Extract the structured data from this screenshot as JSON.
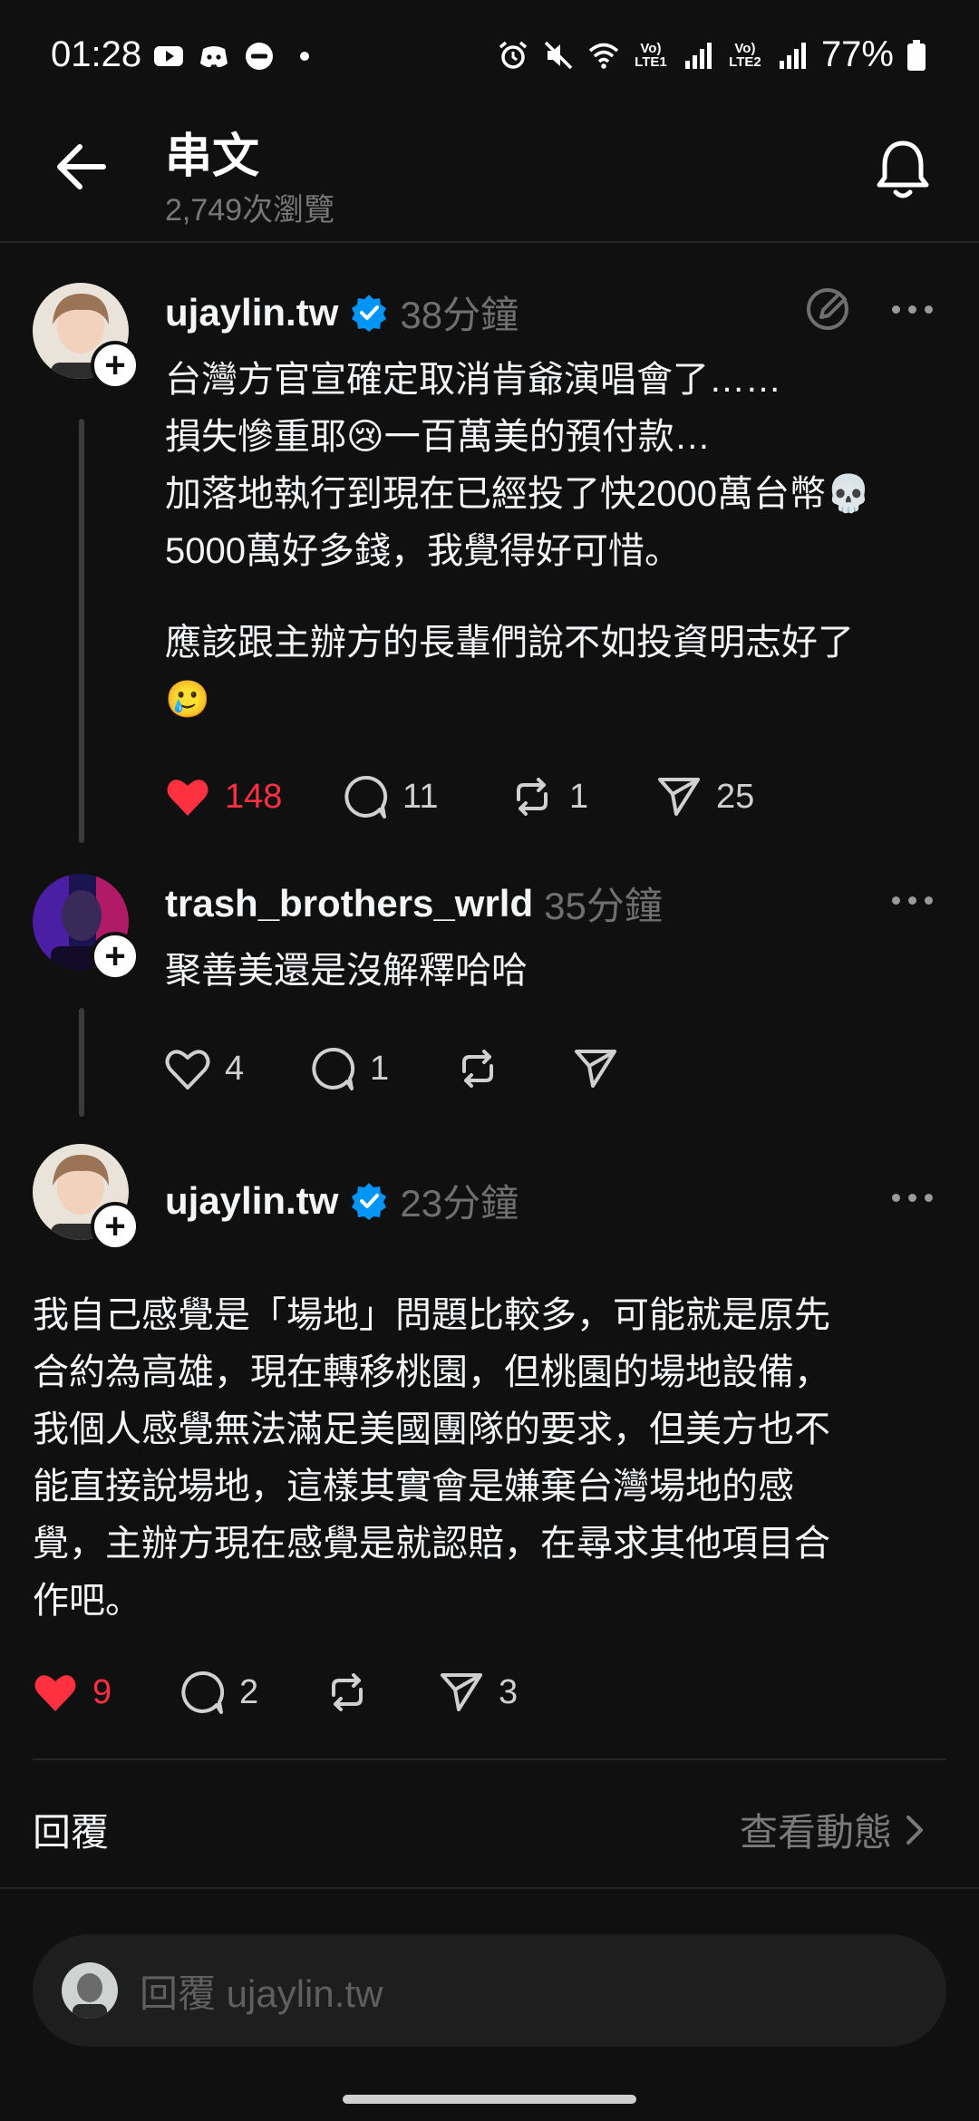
{
  "status_bar": {
    "time": "01:28",
    "battery": "77%",
    "sim1_label": "Vo) LTE1",
    "sim2_label": "Vo) LTE2",
    "icons": [
      "youtube-icon",
      "discord-icon",
      "do-not-disturb-icon",
      "dot-icon",
      "alarm-icon",
      "mute-icon",
      "wifi-icon",
      "signal-icon",
      "battery-icon"
    ]
  },
  "header": {
    "title": "串文",
    "views": "2,749次瀏覽"
  },
  "posts": [
    {
      "username": "ujaylin.tw",
      "verified": true,
      "timestamp": "38分鐘",
      "paragraphs": [
        "台灣方官宣確定取消肯爺演唱會了……\n損失慘重耶😢一百萬美的預付款…\n加落地執行到現在已經投了快2000萬台幣💀\n5000萬好多錢，我覺得好可惜。",
        "應該跟主辦方的長輩們說不如投資明志好了\n🥲"
      ],
      "likes": "148",
      "comments": "11",
      "reposts": "1",
      "shares": "25",
      "liked": true
    },
    {
      "username": "trash_brothers_wrld",
      "verified": false,
      "timestamp": "35分鐘",
      "text": "聚善美還是沒解釋哈哈",
      "likes": "4",
      "comments": "1",
      "reposts": "",
      "shares": "",
      "liked": false
    },
    {
      "username": "ujaylin.tw",
      "verified": true,
      "timestamp": "23分鐘",
      "text": "我自己感覺是「場地」問題比較多，可能就是原先\n合約為高雄，現在轉移桃園，但桃園的場地設備，\n我個人感覺無法滿足美國團隊的要求，但美方也不\n能直接說場地，這樣其實會是嫌棄台灣場地的感\n覺，主辦方現在感覺是就認賠，在尋求其他項目合\n作吧。",
      "likes": "9",
      "comments": "2",
      "reposts": "",
      "shares": "3",
      "liked": true
    }
  ],
  "footer": {
    "reply_label": "回覆",
    "activity_label": "查看動態"
  },
  "reply_bar": {
    "placeholder": "回覆 ujaylin.tw"
  },
  "colors": {
    "background": "#101010",
    "like_red": "#ff3040",
    "verified_blue": "#0095f6",
    "muted_text": "#6f6f6f"
  }
}
